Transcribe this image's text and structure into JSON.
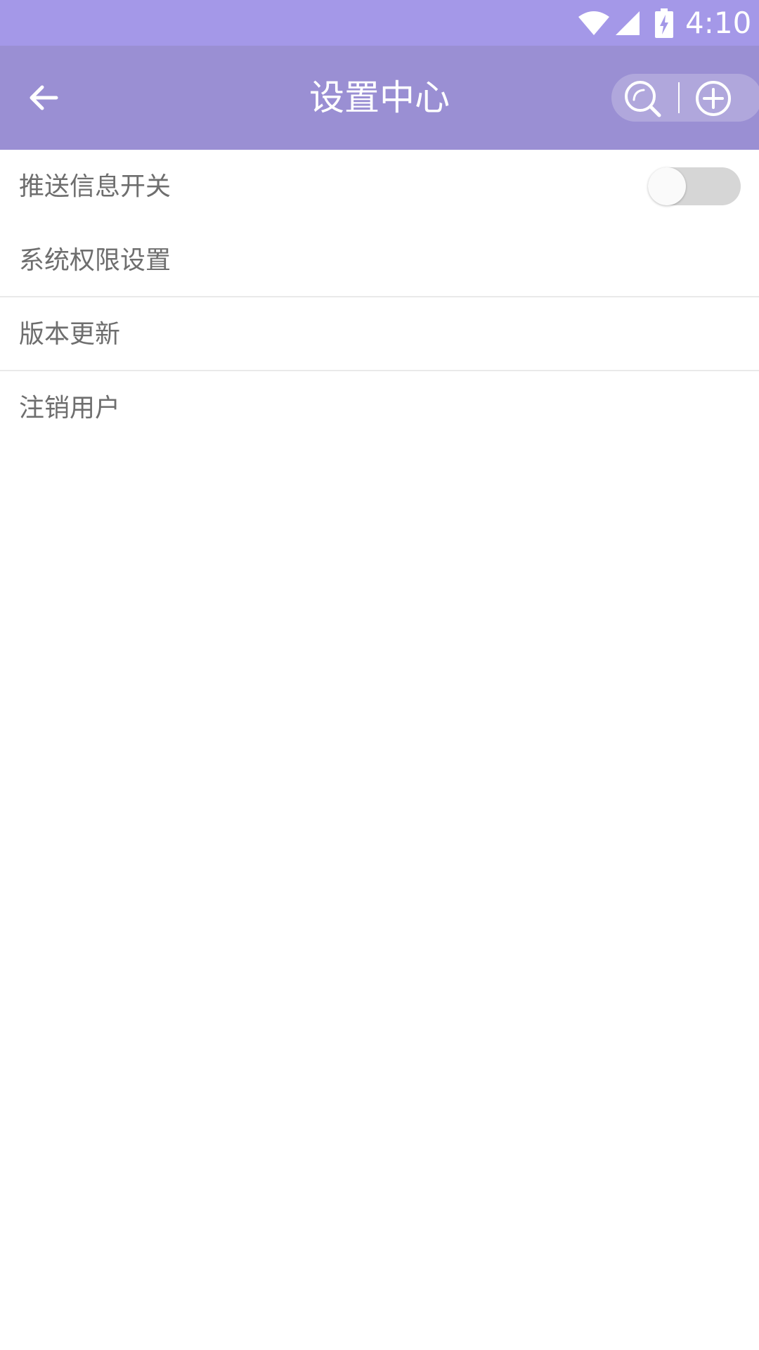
{
  "status_bar": {
    "time": "4:10",
    "icons": [
      "wifi-icon",
      "cell-signal-icon",
      "battery-charging-icon"
    ]
  },
  "app_bar": {
    "title": "设置中心",
    "back_icon": "back-arrow-icon",
    "action_icons": [
      "search-icon",
      "add-circle-icon"
    ]
  },
  "settings": {
    "items": [
      {
        "label": "推送信息开关",
        "type": "toggle",
        "toggle_on": false
      },
      {
        "label": "系统权限设置",
        "type": "link"
      },
      {
        "label": "版本更新",
        "type": "link"
      },
      {
        "label": "注销用户",
        "type": "link"
      }
    ]
  },
  "colors": {
    "status_bar_bg": "#a498e8",
    "app_bar_bg": "#9a8fd3",
    "label_text": "#6e6e6e",
    "toggle_track_off": "#d6d6d6",
    "divider": "#e9e9e9"
  }
}
